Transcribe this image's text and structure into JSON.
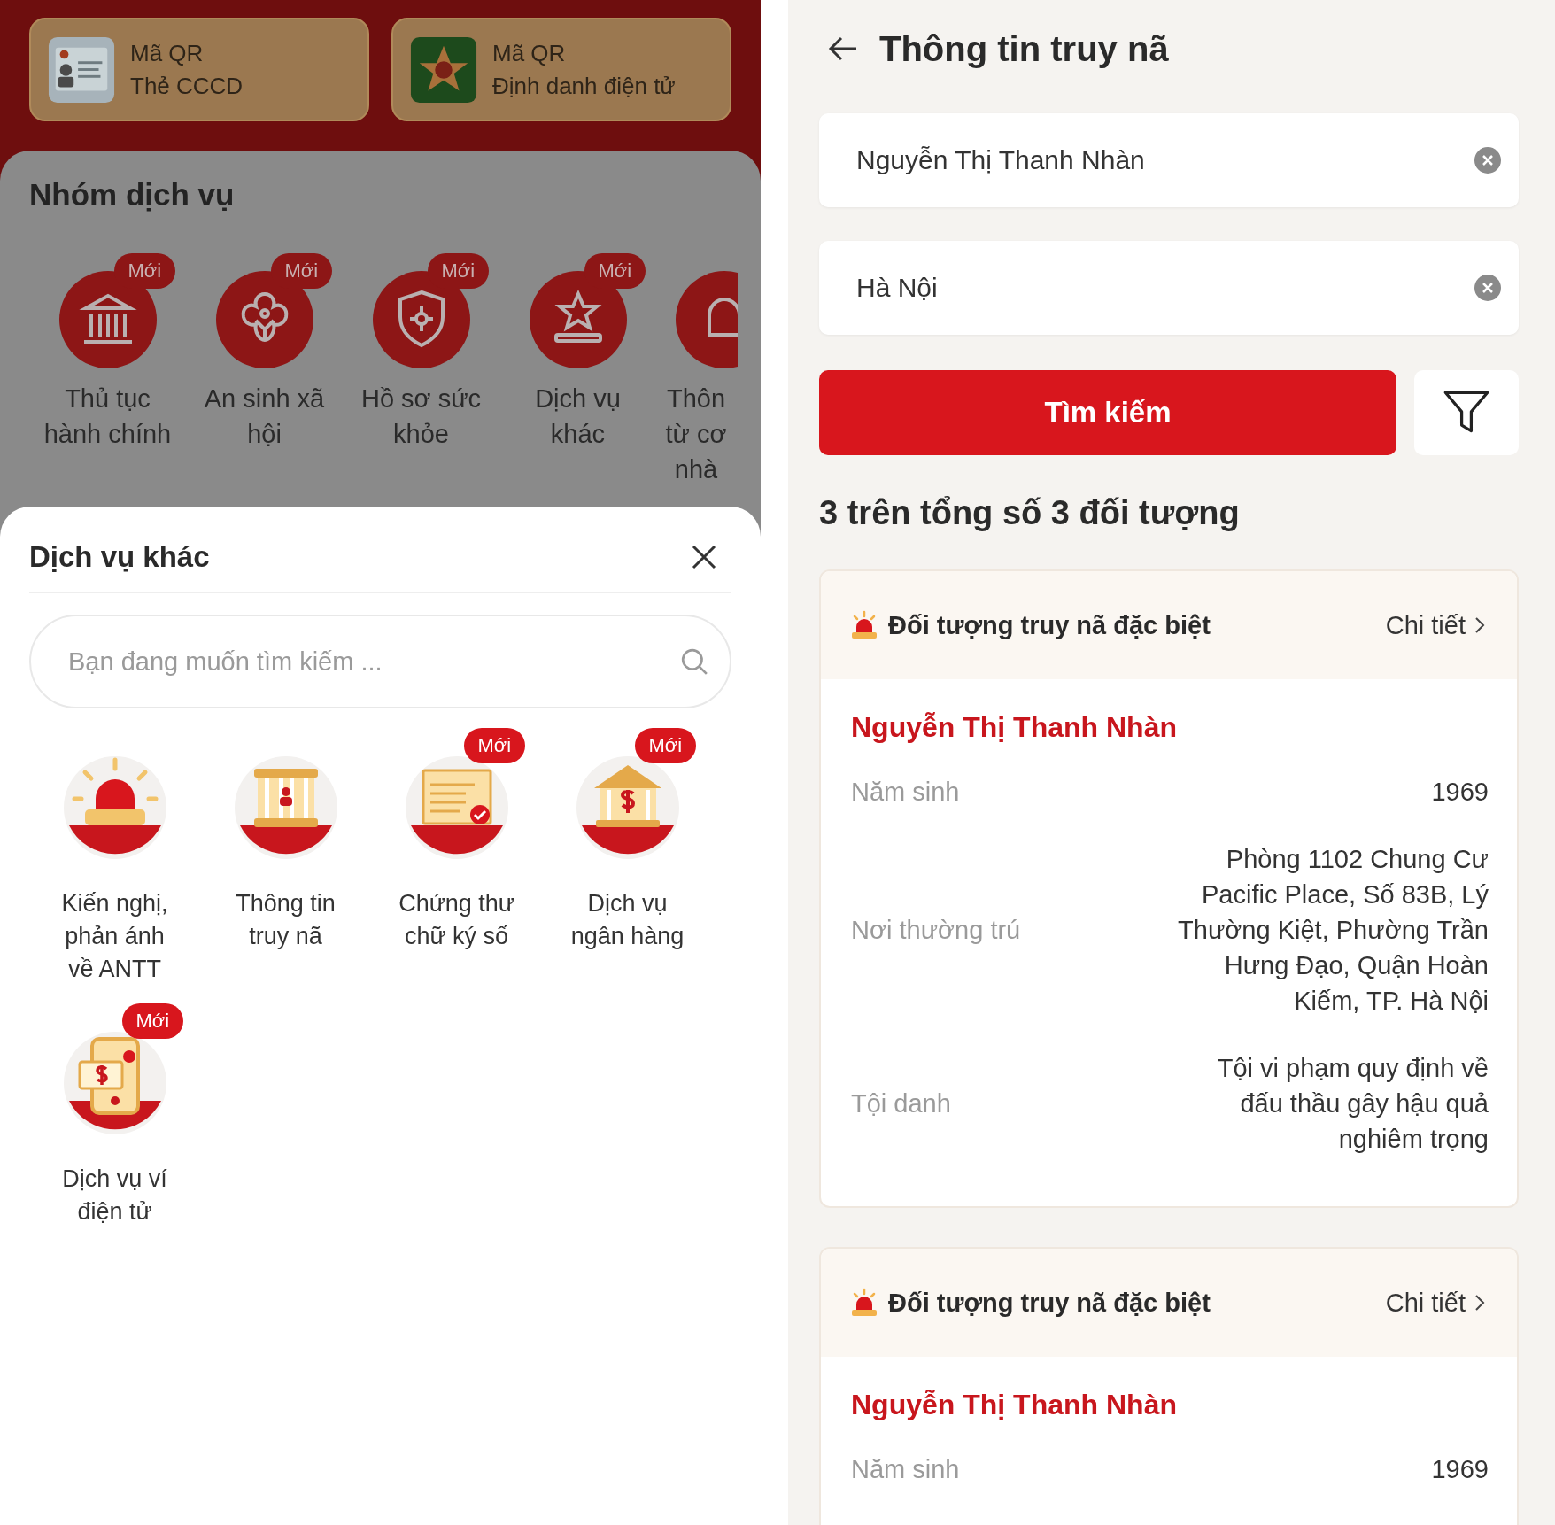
{
  "left": {
    "qr_cards": [
      {
        "line1": "Mã QR",
        "line2": "Thẻ CCCD",
        "kind": "id-card"
      },
      {
        "line1": "Mã QR",
        "line2": "Định danh điện tử",
        "kind": "emblem"
      }
    ],
    "service_group": {
      "title": "Nhóm dịch vụ",
      "items": [
        {
          "label": "Thủ tục hành chính",
          "badge": "Mới",
          "kind": "building"
        },
        {
          "label": "An sinh xã hội",
          "badge": "Mới",
          "kind": "flower"
        },
        {
          "label": "Hồ sơ sức khỏe",
          "badge": "Mới",
          "kind": "shield"
        },
        {
          "label": "Dịch vụ khác",
          "badge": "Mới",
          "kind": "star"
        },
        {
          "label": "Thôn từ cơ nhà",
          "kind": "bell"
        }
      ]
    },
    "sheet": {
      "title": "Dịch vụ khác",
      "search": {
        "placeholder": "Bạn đang muốn tìm kiếm ..."
      },
      "items": [
        {
          "label": "Kiến nghị, phản ánh về ANTT",
          "kind": "siren"
        },
        {
          "label": "Thông tin truy nã",
          "kind": "jail"
        },
        {
          "label": "Chứng thư chữ ký số",
          "badge": "Mới",
          "kind": "certificate"
        },
        {
          "label": "Dịch vụ ngân hàng",
          "badge": "Mới",
          "kind": "bank"
        },
        {
          "label": "Dịch vụ ví điện tử",
          "badge": "Mới",
          "kind": "wallet"
        }
      ]
    }
  },
  "right": {
    "title": "Thông tin truy nã",
    "fields": [
      {
        "value": "Nguyễn Thị Thanh Nhàn"
      },
      {
        "value": "Hà Nội"
      }
    ],
    "search_button": "Tìm kiếm",
    "result_count": "3 trên tổng số 3 đối tượng",
    "results": [
      {
        "category": "Đối tượng truy nã đặc biệt",
        "detail_link": "Chi tiết",
        "name": "Nguyễn Thị Thanh Nhàn",
        "facts": [
          {
            "label": "Năm sinh",
            "value": "1969"
          },
          {
            "label": "Nơi thường trú",
            "value": "Phòng 1102 Chung Cư Pacific Place, Số 83B, Lý Thường Kiệt, Phường Trần Hưng Đạo, Quận Hoàn Kiếm, TP. Hà Nội"
          },
          {
            "label": "Tội danh",
            "value": "Tội vi phạm quy định về đấu thầu gây hậu quả nghiêm trọng"
          }
        ]
      },
      {
        "category": "Đối tượng truy nã đặc biệt",
        "detail_link": "Chi tiết",
        "name": "Nguyễn Thị Thanh Nhàn",
        "facts": [
          {
            "label": "Năm sinh",
            "value": "1969"
          }
        ]
      }
    ]
  }
}
